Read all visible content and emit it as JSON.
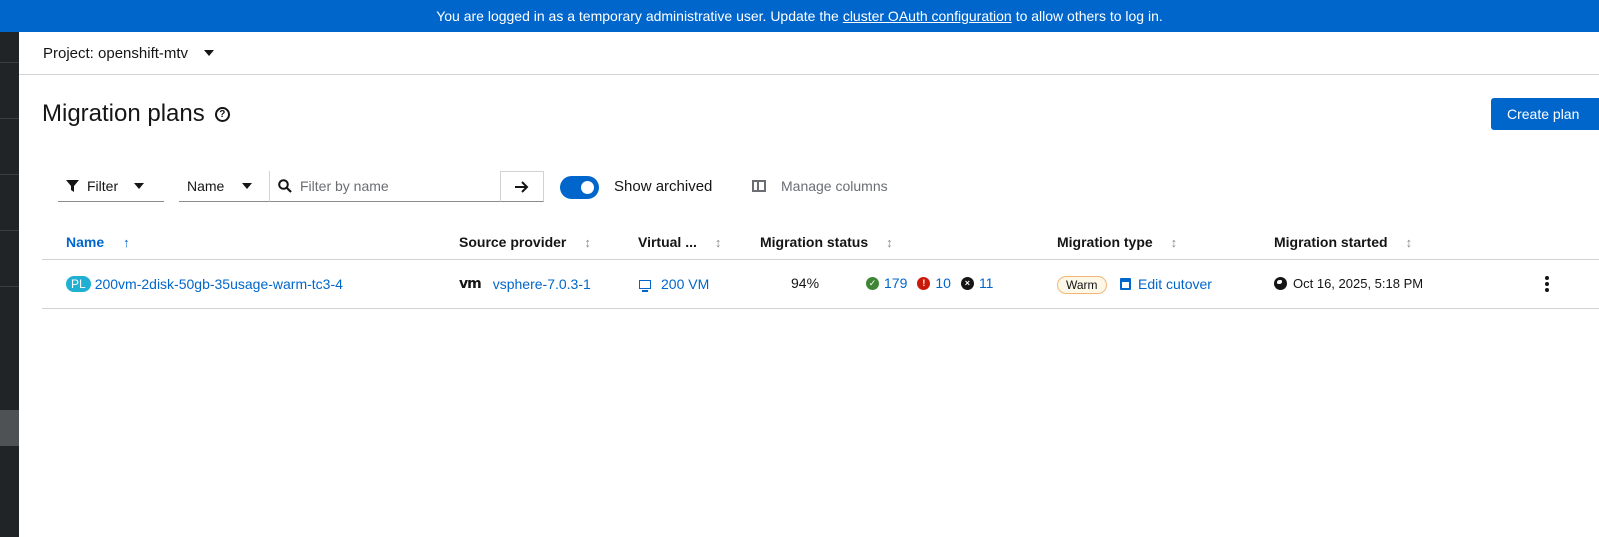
{
  "banner": {
    "text_before": "You are logged in as a temporary administrative user. Update the",
    "link_text": "cluster OAuth configuration",
    "text_after": "to allow others to log in."
  },
  "project": {
    "label": "Project: openshift-mtv"
  },
  "page": {
    "title": "Migration plans",
    "create_label": "Create plan"
  },
  "toolbar": {
    "filter_label": "Filter",
    "attribute_label": "Name",
    "search_placeholder": "Filter by name",
    "search_value": "",
    "show_archived_label": "Show archived",
    "show_archived_on": true,
    "manage_columns_label": "Manage columns"
  },
  "table": {
    "columns": {
      "name": "Name",
      "source": "Source provider",
      "vms": "Virtual ...",
      "status": "Migration status",
      "type": "Migration type",
      "started": "Migration started"
    },
    "rows": [
      {
        "badge": "PL",
        "name": "200vm-2disk-50gb-35usage-warm-tc3-4",
        "provider_logo": "vm",
        "provider": "vsphere-7.0.3-1",
        "vms": "200 VM",
        "progress": "94%",
        "succeeded": "179",
        "failed": "10",
        "canceled": "11",
        "type": "Warm",
        "cutover_label": "Edit cutover",
        "started": "Oct 16, 2025, 5:18 PM"
      }
    ]
  },
  "colors": {
    "primary": "#0066cc",
    "success": "#3e8635",
    "danger": "#c9190b",
    "nav": "#212427"
  },
  "icons": [
    "help-icon",
    "filter-icon",
    "search-icon",
    "arrow-right-icon",
    "columns-icon",
    "sort-icon",
    "monitor-icon",
    "check-circle-icon",
    "exclamation-circle-icon",
    "ban-icon",
    "calendar-icon",
    "globe-icon",
    "kebab-icon"
  ]
}
